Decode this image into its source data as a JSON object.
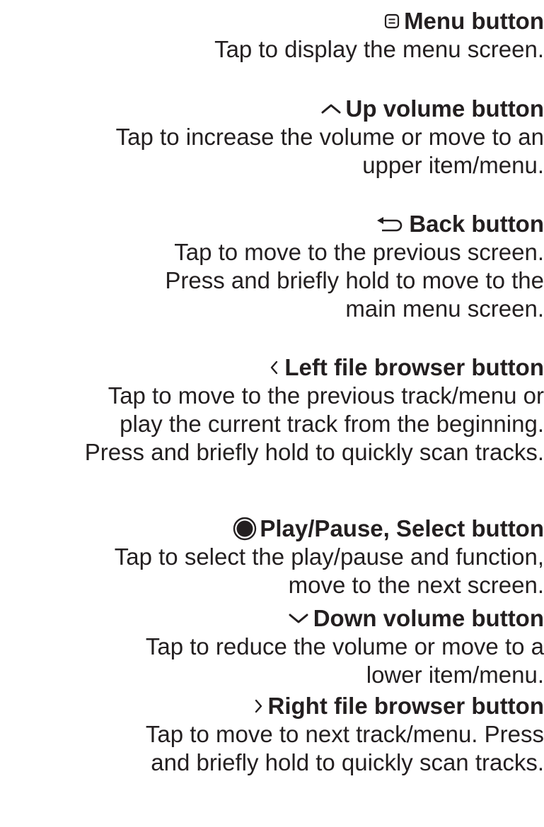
{
  "sections": [
    {
      "icon": "menu-icon",
      "title": "Menu button",
      "lines": [
        "Tap to display the menu screen."
      ]
    },
    {
      "icon": "chevron-up-icon",
      "title": "Up volume button",
      "lines": [
        "Tap to increase the volume or move to an",
        "upper item/menu."
      ]
    },
    {
      "icon": "back-arrow-icon",
      "title": "Back button",
      "lines": [
        "Tap to move to the previous screen.",
        "Press and briefly hold to move to the",
        "main menu screen."
      ]
    },
    {
      "icon": "chevron-left-icon",
      "title": "Left file browser button",
      "lines": [
        "Tap to move to the previous track/menu or",
        "play the current track from the beginning.",
        "Press and briefly hold to quickly scan tracks."
      ]
    },
    {
      "icon": "play-pause-select-icon",
      "title": "Play/Pause, Select button",
      "lines": [
        "Tap to select the play/pause and function,",
        "move to the next screen."
      ]
    },
    {
      "icon": "chevron-down-icon",
      "title": "Down volume button",
      "lines": [
        "Tap to reduce the volume or move to a",
        "lower item/menu."
      ]
    },
    {
      "icon": "chevron-right-icon",
      "title": "Right file browser button",
      "lines": [
        "Tap to move to next track/menu. Press",
        "and briefly hold to quickly scan tracks."
      ]
    }
  ]
}
